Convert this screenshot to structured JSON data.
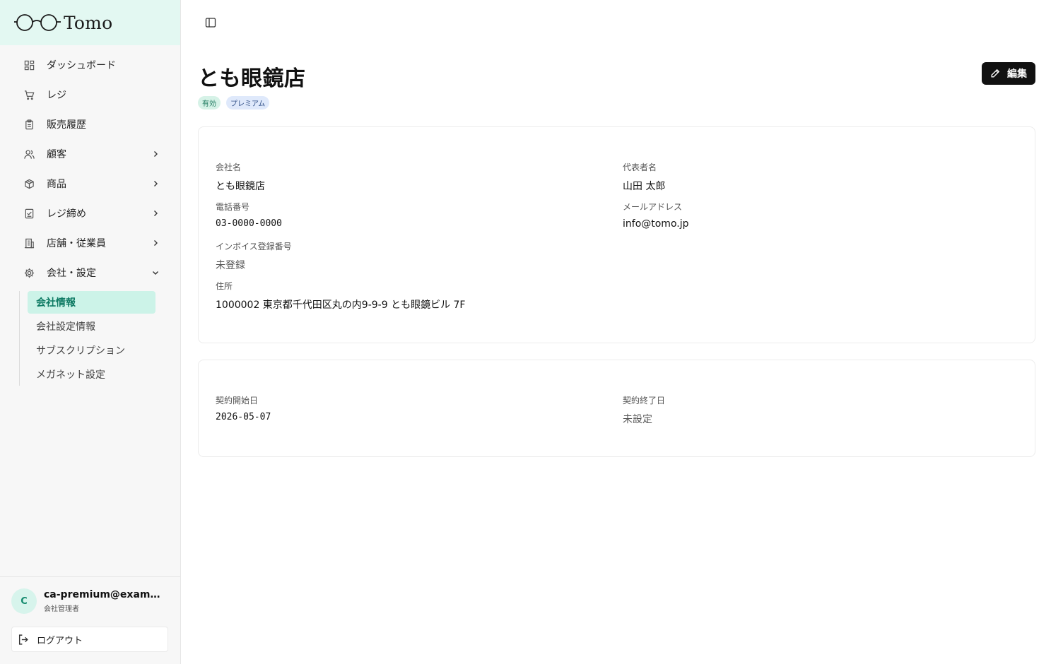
{
  "brand": {
    "name": "Tomo"
  },
  "nav": {
    "items": [
      {
        "label": "ダッシュボード",
        "icon": "dashboard-icon"
      },
      {
        "label": "レジ",
        "icon": "cart-icon"
      },
      {
        "label": "販売履歴",
        "icon": "clipboard-icon"
      },
      {
        "label": "顧客",
        "icon": "users-icon"
      },
      {
        "label": "商品",
        "icon": "package-icon"
      },
      {
        "label": "レジ締め",
        "icon": "checklist-icon"
      },
      {
        "label": "店舗・従業員",
        "icon": "building-icon"
      },
      {
        "label": "会社・設定",
        "icon": "gear-icon"
      }
    ],
    "sub_items": [
      {
        "label": "会社情報",
        "active": true
      },
      {
        "label": "会社設定情報",
        "active": false
      },
      {
        "label": "サブスクリプション",
        "active": false
      },
      {
        "label": "メガネット設定",
        "active": false
      }
    ]
  },
  "user": {
    "initial": "C",
    "email": "ca-premium@example.com",
    "role": "会社管理者",
    "logout_label": "ログアウト"
  },
  "page": {
    "title": "とも眼鏡店",
    "badges": [
      "有効",
      "プレミアム"
    ],
    "edit_label": "編集"
  },
  "company": {
    "name_label": "会社名",
    "name_value": "とも眼鏡店",
    "rep_label": "代表者名",
    "rep_value": "山田 太郎",
    "phone_label": "電話番号",
    "phone_value": "03-0000-0000",
    "email_label": "メールアドレス",
    "email_value": "info@tomo.jp",
    "invoice_label": "インボイス登録番号",
    "invoice_value": "未登録",
    "address_label": "住所",
    "address_value": "1000002 東京都千代田区丸の内9-9-9 とも眼鏡ビル 7F"
  },
  "contract": {
    "start_label": "契約開始日",
    "start_value": "2026-05-07",
    "end_label": "契約終了日",
    "end_value": "未設定"
  },
  "colors": {
    "accent": "#0e7a63",
    "brand_bg": "#e3f8f2",
    "active_bg": "#ccf3e8"
  }
}
